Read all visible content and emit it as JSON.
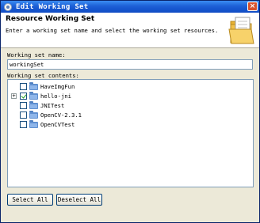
{
  "window": {
    "title": "Edit Working Set",
    "close_label": "×"
  },
  "header": {
    "title": "Resource Working Set",
    "description": "Enter a working set name and select the working set resources.",
    "image_icon": "wizard-folder-image"
  },
  "name_field": {
    "label": "Working set name:",
    "value": "workingSet"
  },
  "contents": {
    "label": "Working set contents:",
    "items": [
      {
        "label": "HaveImgFun",
        "checked": false,
        "expandable": false,
        "icon": "folder-icon"
      },
      {
        "label": "hello-jni",
        "checked": true,
        "expandable": true,
        "icon": "folder-icon"
      },
      {
        "label": "JNITest",
        "checked": false,
        "expandable": false,
        "icon": "folder-icon"
      },
      {
        "label": "OpenCV-2.3.1",
        "checked": false,
        "expandable": false,
        "icon": "folder-icon"
      },
      {
        "label": "OpenCVTest",
        "checked": false,
        "expandable": false,
        "icon": "folder-icon"
      }
    ]
  },
  "buttons": {
    "select_all": "Select All",
    "deselect_all": "Deselect All"
  },
  "colors": {
    "titlebar": "#1d5fd6",
    "dialog_bg": "#ece9d8",
    "checkmark": "#21a121",
    "folder": "#5f8fd0"
  }
}
